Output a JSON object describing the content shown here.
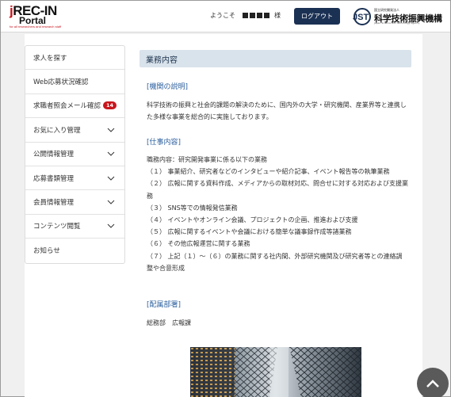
{
  "header": {
    "logo": {
      "line1_j": "j",
      "line1_rest": "REC-IN",
      "line2": "Portal",
      "tagline": "for all researchers and research staff"
    },
    "welcome_prefix": "ようこそ",
    "welcome_suffix": "様",
    "logout_label": "ログアウト",
    "org": {
      "small": "国立研究開発法人",
      "name": "科学技術振興機構",
      "english": "Japan Science and Technology Agency",
      "mark": "JST"
    }
  },
  "sidebar": {
    "items": [
      {
        "label": "求人を探す",
        "chevron": false
      },
      {
        "label": "Web応募状況確認",
        "chevron": false
      },
      {
        "label": "求職者照会メール確認",
        "badge": "14",
        "chevron": false
      },
      {
        "label": "お気に入り管理",
        "chevron": true
      },
      {
        "label": "公開情報管理",
        "chevron": true
      },
      {
        "label": "応募書類管理",
        "chevron": true
      },
      {
        "label": "会員情報管理",
        "chevron": true
      },
      {
        "label": "コンテンツ閲覧",
        "chevron": true
      },
      {
        "label": "お知らせ",
        "chevron": false
      }
    ]
  },
  "main": {
    "section_title": "業務内容",
    "org_heading": "[機関の説明]",
    "org_text": "科学技術の振興と社会的課題の解決のために、国内外の大学・研究機関、産業界等と連携した多様な事業を総合的に実施しております。",
    "job_heading": "[仕事内容]",
    "job_lines": [
      "職務内容：研究開発事業に係る以下の業務",
      "（１） 事業紹介、研究者などのインタビューや紹介記事、イベント報告等の執筆業務",
      "（２） 広報に関する資料作成、メディアからの取材対応、問合せに対する対応および支援業務",
      "（３） SNS等での情報発信業務",
      "（４） イベントやオンライン会議、プロジェクトの企画、推進および支援",
      "（５） 広報に関するイベントや会議における簡単な議事録作成等諸業務",
      "（６） その他広報運営に関する業務",
      "（７） 上記（１）～（６）の業務に関する社内間、外部研究機関及び研究者等との連絡調整や合意形成"
    ],
    "dept_heading": "[配属部署]",
    "dept_text": "総務部　広報課"
  },
  "colors": {
    "brand_navy": "#1b3154",
    "accent_red": "#c8161d",
    "link_blue": "#2b5f9e",
    "section_bg": "#d9e3eb"
  }
}
